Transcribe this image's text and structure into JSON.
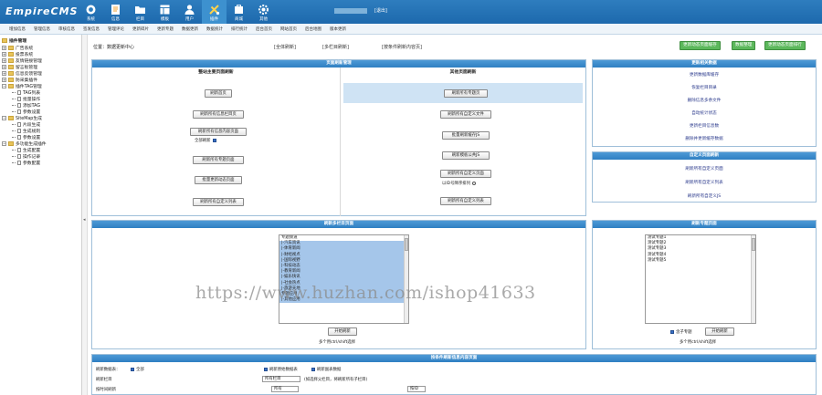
{
  "app": {
    "logo": "EmpireCMS",
    "logout": "[退出]"
  },
  "nav": [
    {
      "label": "系统",
      "icon": "system-icon"
    },
    {
      "label": "信息",
      "icon": "document-icon"
    },
    {
      "label": "栏目",
      "icon": "folder-icon"
    },
    {
      "label": "模板",
      "icon": "template-icon"
    },
    {
      "label": "用户",
      "icon": "user-icon"
    },
    {
      "label": "插件",
      "icon": "plugin-icon"
    },
    {
      "label": "商城",
      "icon": "mall-icon"
    },
    {
      "label": "其他",
      "icon": "gear-icon"
    }
  ],
  "subnav": [
    "增加信息",
    "管理信息",
    "审核信息",
    "签发信息",
    "管理评论",
    "更新碎片",
    "更新专题",
    "数据更新",
    "数据统计",
    "排行统计",
    "后台首页",
    "网站首页",
    "后台地图",
    "版本更新"
  ],
  "sidebar": {
    "root": "插件管理",
    "items": [
      {
        "label": "广告系统",
        "level": 0,
        "type": "folder"
      },
      {
        "label": "投票系统",
        "level": 0,
        "type": "folder"
      },
      {
        "label": "友情链接管理",
        "level": 0,
        "type": "folder"
      },
      {
        "label": "留言板管理",
        "level": 0,
        "type": "folder"
      },
      {
        "label": "信息反馈管理",
        "level": 0,
        "type": "folder"
      },
      {
        "label": "防采集插件",
        "level": 0,
        "type": "folder"
      },
      {
        "label": "插件TAG管理",
        "level": 0,
        "type": "folder-open"
      },
      {
        "label": "TAG列表",
        "level": 1,
        "type": "doc"
      },
      {
        "label": "批量操作",
        "level": 1,
        "type": "doc"
      },
      {
        "label": "添加TAG",
        "level": 1,
        "type": "doc"
      },
      {
        "label": "参数设置",
        "level": 1,
        "type": "doc"
      },
      {
        "label": "SiteMap生成",
        "level": 0,
        "type": "folder-open"
      },
      {
        "label": "片段生成",
        "level": 1,
        "type": "doc"
      },
      {
        "label": "生成规则",
        "level": 1,
        "type": "doc"
      },
      {
        "label": "参数设置",
        "level": 1,
        "type": "doc"
      },
      {
        "label": "多功能生成插件",
        "level": 0,
        "type": "folder-open"
      },
      {
        "label": "生成配置",
        "level": 1,
        "type": "doc"
      },
      {
        "label": "操作记录",
        "level": 1,
        "type": "doc"
      },
      {
        "label": "参数配置",
        "level": 1,
        "type": "doc"
      }
    ]
  },
  "breadcrumb": {
    "location": "位置：数据更新中心",
    "links": [
      "[全体刷新]",
      "[多栏目刷新]",
      "[按条件刷新内容页]"
    ]
  },
  "top_buttons": [
    "更新动态页面缓存",
    "数据整理",
    "更新动态页面排行"
  ],
  "main_panel": {
    "title": "页面刷新管理",
    "left_header": "整站主要页面刷新",
    "right_header": "其他页面刷新",
    "left_buttons": [
      "刷新首页",
      "刷新所有信息栏目页",
      "刷新所有信息内容页面",
      "刷新所有专题页面",
      "批量更新动态页面",
      "刷新所有自定义列表"
    ],
    "left_checkbox_label": "全部刷新",
    "right_buttons": [
      "刷新所有专题页",
      "刷新所有自定义文件",
      "批量刷新缓存JS",
      "刷新模板公共JS",
      "刷新所有自定义页面",
      "刷新所有自定义列表"
    ],
    "right_checkbox_label": "以ID号降序排列"
  },
  "side_panel": {
    "title": "更新相关数据",
    "links": [
      "更新数据库缓存",
      "恢复栏目目录",
      "删除信息多余文件",
      "自动统计状态",
      "更新栏目信息数",
      "删除并更新缓存数据"
    ]
  },
  "custom_panel": {
    "title": "自定义页面刷新",
    "links": [
      "刷新所有自定义页面",
      "刷新所有自定义列表",
      "刷新所有自定义JS"
    ]
  },
  "column_panel": {
    "title": "刷新多栏目页面",
    "options": [
      "专题频道",
      "|-汽车资讯",
      "|-体育新闻",
      "|-财经视点",
      "|-国际视野",
      "|-科技动态",
      "|-教育新闻",
      "|-娱乐快讯",
      "|-社会热点",
      "|-旅游天地",
      "专题应用",
      "|-其他应用"
    ],
    "button": "开始刷新",
    "hint": "多个用ctrl/shift选择"
  },
  "topic_panel": {
    "title": "刷新专题页面",
    "options": [
      "测试专题1",
      "测试专题2",
      "测试专题3",
      "测试专题4",
      "测试专题5"
    ],
    "checkbox_label": "含子专题",
    "button": "开始刷新",
    "hint": "多个用ctrl/shift选择"
  },
  "bottom_panel": {
    "title": "按条件刷新信息内容页面",
    "row1_label": "刷新数据表：",
    "row1_all": "全部",
    "row1_opt1": "刷新原始数据表",
    "row1_opt2": "刷新副表数据",
    "row2_label": "刷新栏目",
    "row2_select": "所有栏目",
    "row2_hint": "(如选择父栏目，将刷新所有子栏目)",
    "row3_label": "按时间刷新",
    "row3_select1": "所有",
    "row3_select2": "按ID"
  },
  "watermark": "https://www.huzhan.com/ishop41633"
}
